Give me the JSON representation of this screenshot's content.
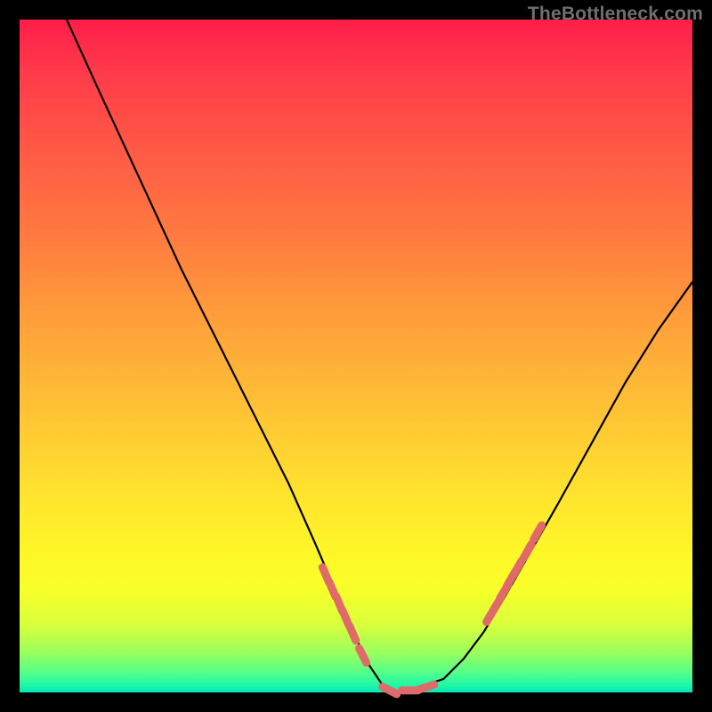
{
  "watermark": "TheBottleneck.com",
  "colors": {
    "background": "#000000",
    "curve_stroke": "#000000",
    "marker_fill": "#E06A6A",
    "watermark_text": "#6f6f6f"
  },
  "chart_data": {
    "type": "line",
    "title": "",
    "xlabel": "",
    "ylabel": "",
    "xlim": [
      0,
      100
    ],
    "ylim": [
      0,
      100
    ],
    "grid": false,
    "legend": false,
    "note": "V-shaped bottleneck curve; minimum indicates balanced configuration. Axis ticks/labels are not shown in the image, so x/y are normalized 0-100.",
    "series": [
      {
        "name": "bottleneck-curve",
        "x": [
          7,
          12,
          18,
          24,
          30,
          36,
          40,
          44,
          47,
          50,
          52,
          54,
          56,
          58,
          60,
          63,
          66,
          69,
          72,
          76,
          80,
          85,
          90,
          95,
          100
        ],
        "y": [
          100,
          89,
          76,
          63,
          51,
          39,
          31,
          22,
          15,
          8,
          4,
          1,
          0,
          0,
          1,
          2,
          5,
          9,
          14,
          21,
          28,
          37,
          46,
          54,
          61
        ]
      }
    ],
    "markers": [
      {
        "name": "highlight-cluster-left",
        "x": [
          45.5,
          46.5,
          47.5,
          48.5,
          49.5,
          51.0,
          55.0,
          58.0,
          60.5
        ],
        "y": [
          17.5,
          15.3,
          13.2,
          11.0,
          8.8,
          5.5,
          0.3,
          0.3,
          0.8
        ]
      },
      {
        "name": "highlight-cluster-right",
        "x": [
          70.0,
          71.0,
          72.0,
          73.0,
          74.0,
          75.5,
          77.0
        ],
        "y": [
          11.5,
          13.2,
          15.0,
          16.8,
          18.5,
          21.0,
          23.8
        ]
      }
    ]
  }
}
